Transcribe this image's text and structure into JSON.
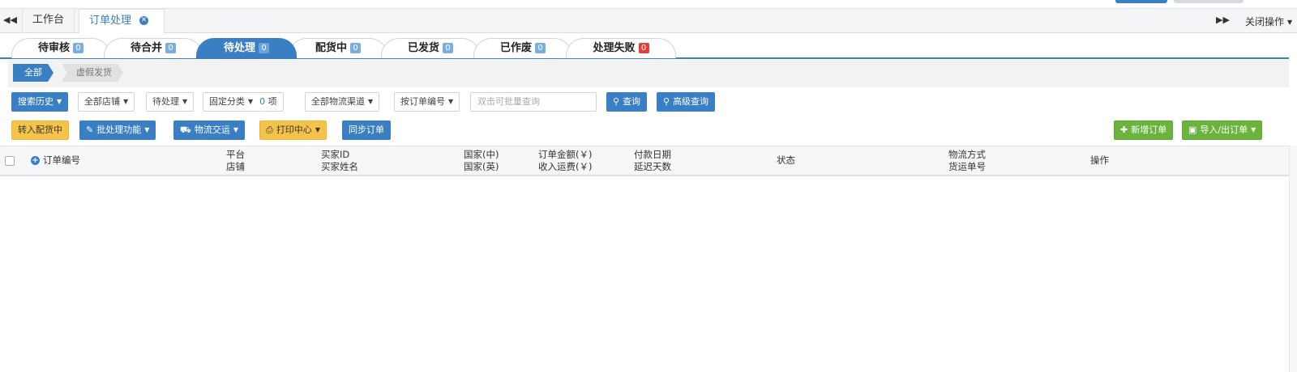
{
  "window_tabs": {
    "home": "工作台",
    "active": "订单处理",
    "close_operations": "关闭操作"
  },
  "status_tabs": [
    {
      "label": "待审核",
      "count": "0"
    },
    {
      "label": "待合并",
      "count": "0"
    },
    {
      "label": "待处理",
      "count": "0"
    },
    {
      "label": "配货中",
      "count": "0"
    },
    {
      "label": "已发货",
      "count": "0"
    },
    {
      "label": "已作废",
      "count": "0"
    },
    {
      "label": "处理失败",
      "count": "0"
    }
  ],
  "sub_filters": {
    "all": "全部",
    "virtual": "虚假发货"
  },
  "filters": {
    "search_history": "搜索历史",
    "all_stores": "全部店铺",
    "pending": "待处理",
    "fixed_category": "固定分类",
    "item_count": "0",
    "item_unit": "项",
    "logistics": "全部物流渠道",
    "by_order_no": "按订单编号",
    "search_placeholder": "双击可批量查询",
    "query": "查询",
    "advanced_query": "高级查询"
  },
  "actions": {
    "to_picking": "转入配货中",
    "batch": "批处理功能",
    "logistics_handover": "物流交运",
    "print_center": "打印中心",
    "sync_orders": "同步订单",
    "new_order": "新增订单",
    "import_export": "导入/出订单"
  },
  "table_header": {
    "order_no": "订单编号",
    "platform": "平台",
    "store": "店铺",
    "buyer_id": "买家ID",
    "buyer_name": "买家姓名",
    "country_cn": "国家(中)",
    "country_en": "国家(英)",
    "order_amount": "订单金额(￥)",
    "shipping_income": "收入运费(￥)",
    "pay_date": "付款日期",
    "delay_days": "延迟天数",
    "status": "状态",
    "shipping_method": "物流方式",
    "tracking_no": "货运单号",
    "operation": "操作"
  },
  "colors": {
    "primary": "#3a7ec3",
    "warning": "#f5c34a",
    "success": "#6ab43e",
    "danger": "#e2413a"
  }
}
